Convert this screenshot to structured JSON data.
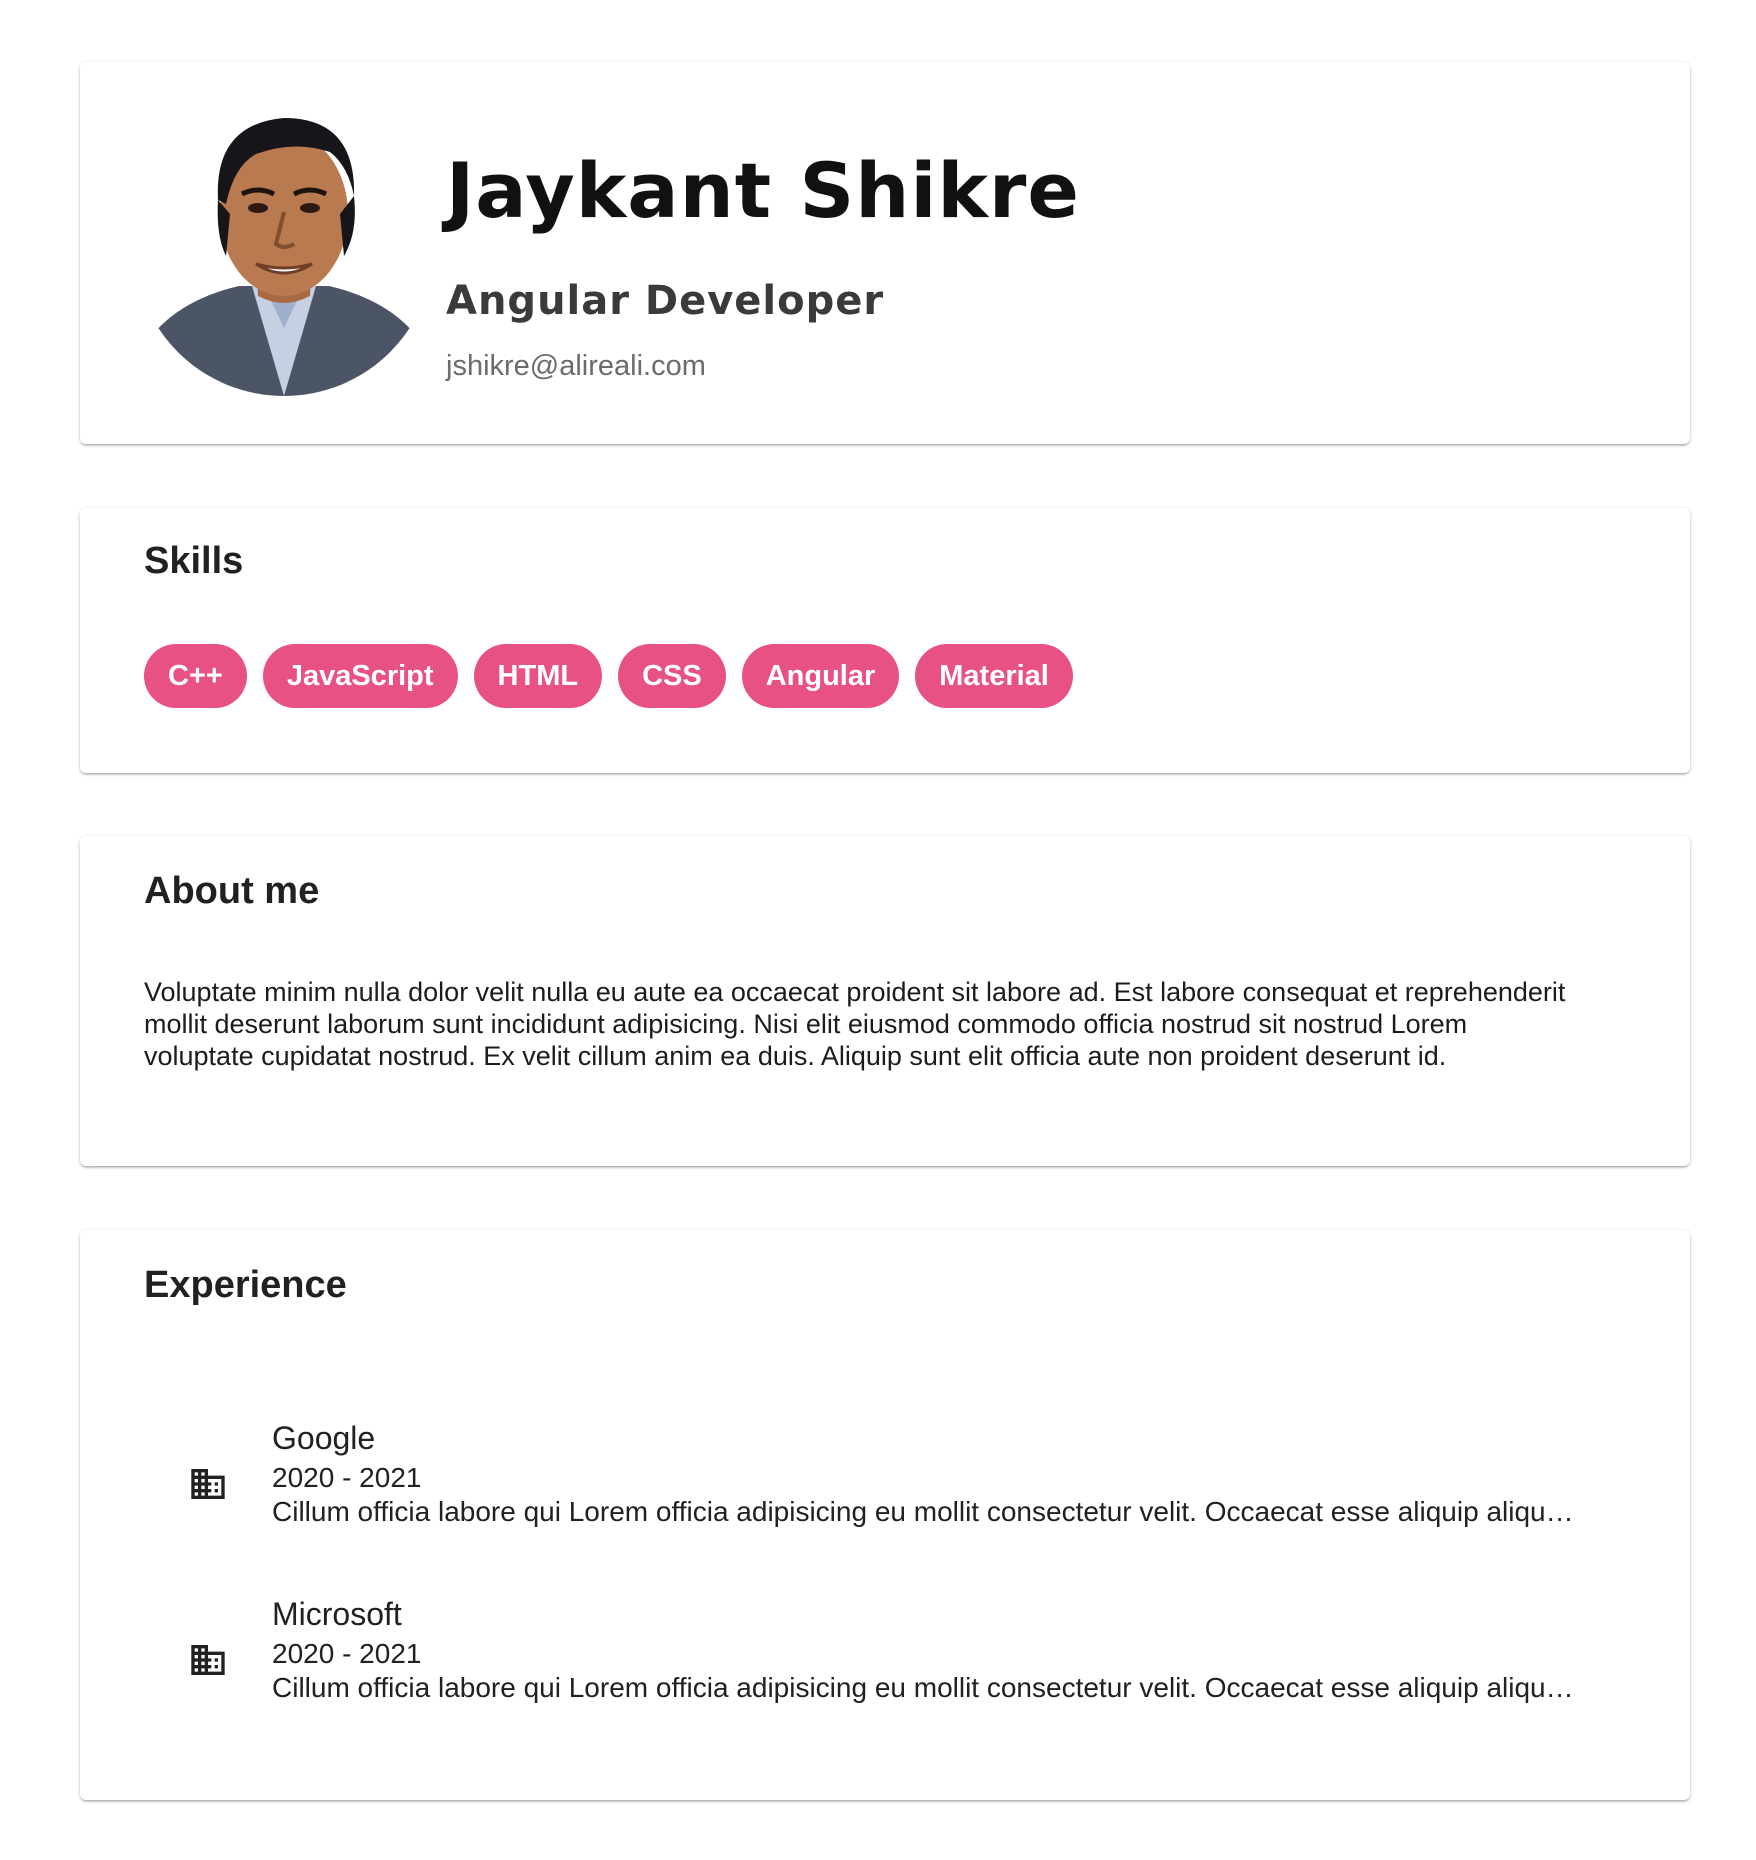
{
  "profile": {
    "name": "Jaykant Shikre",
    "role": "Angular Developer",
    "email": "jshikre@alireali.com"
  },
  "skills": {
    "title": "Skills",
    "chip_color": "#e85283",
    "items": [
      "C++",
      "JavaScript",
      "HTML",
      "CSS",
      "Angular",
      "Material"
    ]
  },
  "about": {
    "title": "About me",
    "text": "Voluptate minim nulla dolor velit nulla eu aute ea occaecat proident sit labore ad. Est labore consequat et reprehenderit mollit deserunt laborum sunt incididunt adipisicing. Nisi elit eiusmod commodo officia nostrud sit nostrud Lorem voluptate cupidatat nostrud. Ex velit cillum anim ea duis. Aliquip sunt elit officia aute non proident deserunt id."
  },
  "experience": {
    "title": "Experience",
    "items": [
      {
        "icon": "business-icon",
        "company": "Google",
        "years": "2020 - 2021",
        "description": "Cillum officia labore qui Lorem officia adipisicing eu mollit consectetur velit. Occaecat esse aliquip aliqua laboris"
      },
      {
        "icon": "business-icon",
        "company": "Microsoft",
        "years": "2020 - 2021",
        "description": "Cillum officia labore qui Lorem officia adipisicing eu mollit consectetur velit. Occaecat esse aliquip aliqua laboris"
      }
    ]
  }
}
